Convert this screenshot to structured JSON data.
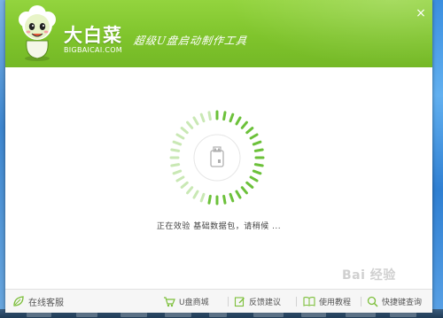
{
  "window": {
    "brand": "大白菜",
    "brand_sub": "BIGBAICAI.COM",
    "slogan": "超级U盘启动制作工具",
    "close_glyph": "×"
  },
  "status": {
    "text": "正在效验 基础数据包，请稍候 ..."
  },
  "footer": {
    "items": [
      {
        "label": "在线客服",
        "icon": "leaf-icon"
      },
      {
        "label": "U盘商城",
        "icon": "cart-icon"
      },
      {
        "label": "反馈建议",
        "icon": "edit-icon"
      },
      {
        "label": "使用教程",
        "icon": "book-icon"
      },
      {
        "label": "快捷键查询",
        "icon": "search-icon"
      }
    ]
  },
  "watermark": "Bai 经验",
  "colors": {
    "accent_green": "#7fc42c",
    "loader_green": "#6cc13a",
    "loader_light": "#c9e8b4"
  }
}
